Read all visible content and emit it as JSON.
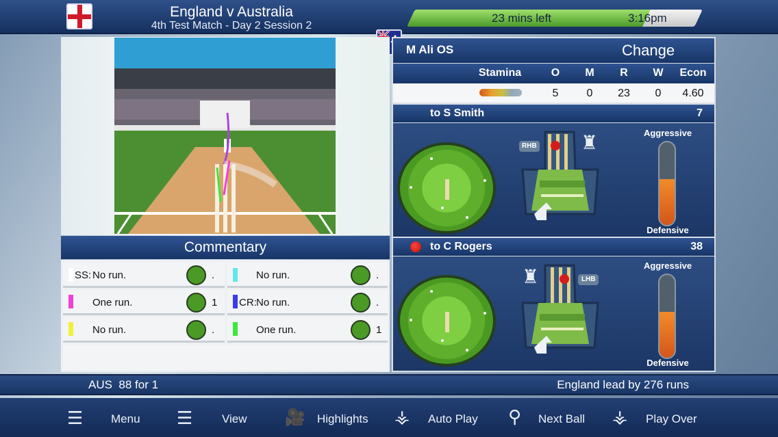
{
  "header": {
    "title": "England v Australia",
    "subtitle": "4th Test Match - Day 2 Session 2",
    "time_left": "23 mins left",
    "clock": "3:16pm",
    "time_progress": 0.82
  },
  "bowler": {
    "name": "M Ali OS",
    "change_label": "Change",
    "stats_headers": [
      "Stamina",
      "O",
      "M",
      "R",
      "W",
      "Econ"
    ],
    "stats_values": [
      "5",
      "0",
      "23",
      "0",
      "4.60"
    ]
  },
  "batter1": {
    "label": "to S Smith",
    "score": "7",
    "hand": "RHB",
    "aggressive_label": "Aggressive",
    "defensive_label": "Defensive",
    "aggression": 0.55
  },
  "batter2": {
    "label": "to C Rogers",
    "score": "38",
    "hand": "LHB",
    "aggressive_label": "Aggressive",
    "defensive_label": "Defensive",
    "aggression": 0.55
  },
  "commentary": {
    "title": "Commentary",
    "rows": [
      {
        "left": {
          "color": "#ffffff",
          "prefix": "SS:",
          "text": "No run.",
          "runs": "."
        },
        "right": {
          "color": "#5ee8ee",
          "prefix": "",
          "text": "No run.",
          "runs": "."
        }
      },
      {
        "left": {
          "color": "#f040d8",
          "prefix": "",
          "text": "One run.",
          "runs": "1"
        },
        "right": {
          "color": "#3a3aee",
          "prefix": "CR:",
          "text": "No run.",
          "runs": "."
        }
      },
      {
        "left": {
          "color": "#f2f03a",
          "prefix": "",
          "text": "No run.",
          "runs": "."
        },
        "right": {
          "color": "#3ee83a",
          "prefix": "",
          "text": "One run.",
          "runs": "1"
        }
      }
    ]
  },
  "scoreline": {
    "left": "AUS  88 for 1",
    "right": "England lead by 276 runs"
  },
  "menu": {
    "menu": "Menu",
    "view": "View",
    "highlights": "Highlights",
    "auto_play": "Auto Play",
    "next_ball": "Next Ball",
    "play_over": "Play Over"
  },
  "colors": {
    "accent": "#1c3766",
    "pitch": "#d9a56c",
    "field": "#5fae2c",
    "gauge": "#e0701f"
  }
}
